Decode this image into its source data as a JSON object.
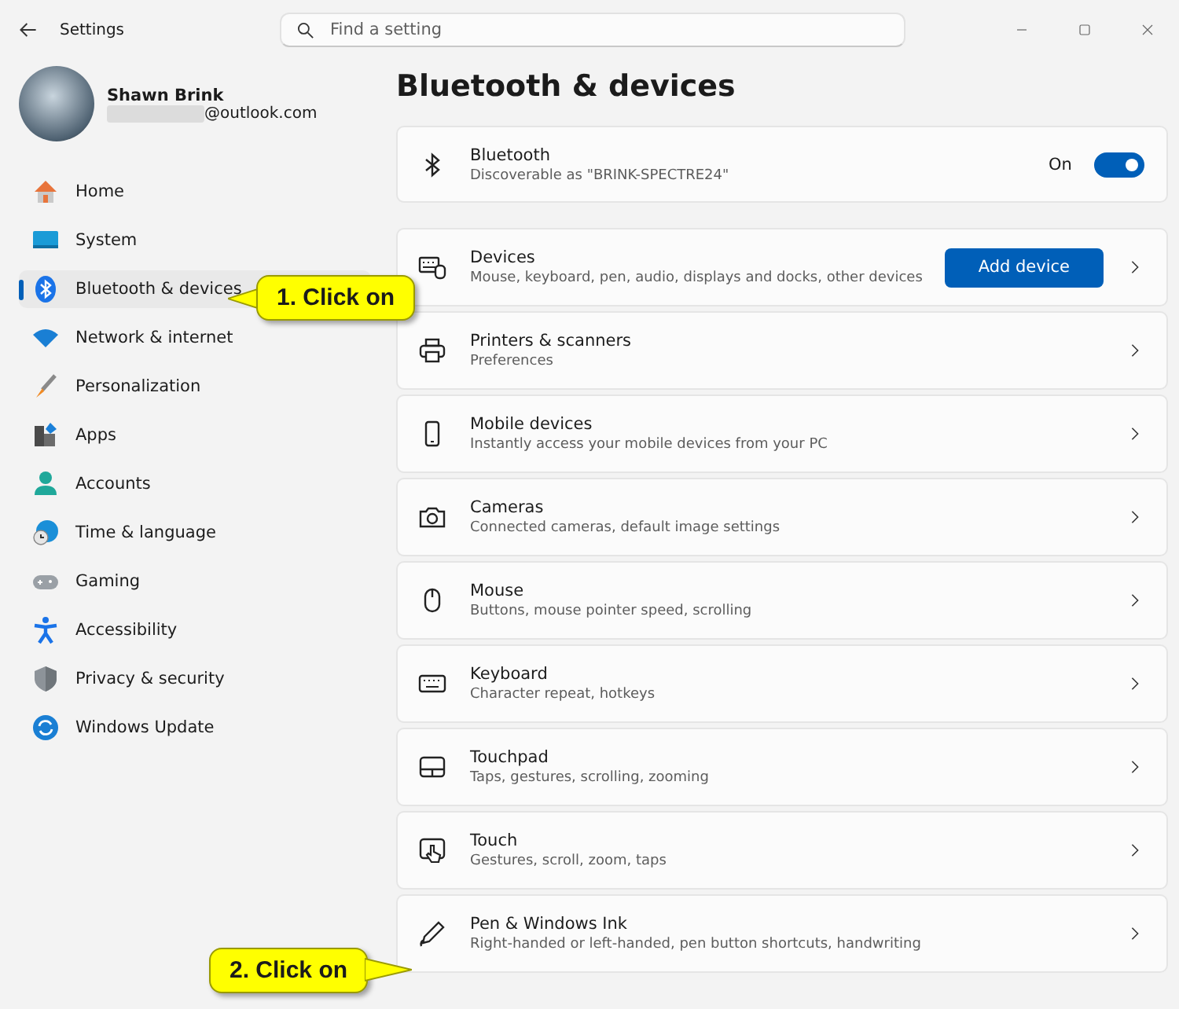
{
  "window": {
    "title": "Settings"
  },
  "search": {
    "placeholder": "Find a setting"
  },
  "account": {
    "name": "Shawn Brink",
    "email": "@outlook.com"
  },
  "sidebar": {
    "items": [
      {
        "label": "Home",
        "selected": false
      },
      {
        "label": "System",
        "selected": false
      },
      {
        "label": "Bluetooth & devices",
        "selected": true
      },
      {
        "label": "Network & internet",
        "selected": false
      },
      {
        "label": "Personalization",
        "selected": false
      },
      {
        "label": "Apps",
        "selected": false
      },
      {
        "label": "Accounts",
        "selected": false
      },
      {
        "label": "Time & language",
        "selected": false
      },
      {
        "label": "Gaming",
        "selected": false
      },
      {
        "label": "Accessibility",
        "selected": false
      },
      {
        "label": "Privacy & security",
        "selected": false
      },
      {
        "label": "Windows Update",
        "selected": false
      }
    ]
  },
  "page_title": "Bluetooth & devices",
  "cards": [
    {
      "kind": "toggle",
      "title": "Bluetooth",
      "subtitle": "Discoverable as \"BRINK-SPECTRE24\"",
      "state_label": "On",
      "on": true
    },
    {
      "kind": "button",
      "title": "Devices",
      "subtitle": "Mouse, keyboard, pen, audio, displays and docks, other devices",
      "button": "Add device"
    },
    {
      "kind": "link",
      "title": "Printers & scanners",
      "subtitle": "Preferences"
    },
    {
      "kind": "link",
      "title": "Mobile devices",
      "subtitle": "Instantly access your mobile devices from your PC"
    },
    {
      "kind": "link",
      "title": "Cameras",
      "subtitle": "Connected cameras, default image settings"
    },
    {
      "kind": "link",
      "title": "Mouse",
      "subtitle": "Buttons, mouse pointer speed, scrolling"
    },
    {
      "kind": "link",
      "title": "Keyboard",
      "subtitle": "Character repeat, hotkeys"
    },
    {
      "kind": "link",
      "title": "Touchpad",
      "subtitle": "Taps, gestures, scrolling, zooming"
    },
    {
      "kind": "link",
      "title": "Touch",
      "subtitle": "Gestures, scroll, zoom, taps"
    },
    {
      "kind": "link",
      "title": "Pen & Windows Ink",
      "subtitle": "Right-handed or left-handed, pen button shortcuts, handwriting"
    }
  ],
  "callouts": [
    {
      "text": "1. Click on"
    },
    {
      "text": "2. Click on"
    }
  ]
}
